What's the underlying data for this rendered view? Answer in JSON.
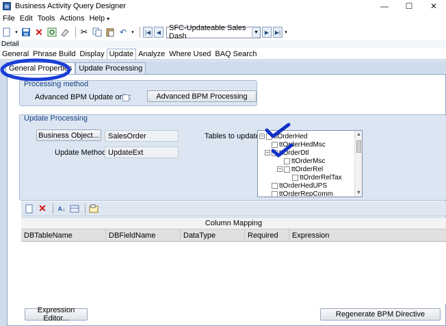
{
  "window": {
    "title": "Business Activity Query Designer",
    "controls": [
      "—",
      "☐",
      "✕"
    ]
  },
  "menu": [
    "File",
    "Edit",
    "Tools",
    "Actions",
    "Help"
  ],
  "toolbar": {
    "query_combo": "SFC-Updateable Sales Dash"
  },
  "detail_label": "Detail",
  "main_tabs": [
    "General",
    "Phrase Build",
    "Display",
    "Update",
    "Analyze",
    "Where Used",
    "BAQ Search"
  ],
  "sub_tabs": [
    "General Properties",
    "Update Processing"
  ],
  "processing_method": {
    "title": "Processing method",
    "adv_bpm_label": "Advanced BPM Update only:",
    "adv_bpm_button": "Advanced BPM Processing"
  },
  "update_processing": {
    "title": "Update Processing",
    "business_object_button": "Business Object...",
    "business_object_value": "SalesOrder",
    "update_method_label": "Update Method:",
    "update_method_value": "UpdateExt",
    "tables_label": "Tables to update:",
    "tree": [
      {
        "text": "ttOrderHed"
      },
      {
        "text": "ttOrderHedMsc"
      },
      {
        "text": "ttOrderDtl"
      },
      {
        "text": "ttOrderMsc"
      },
      {
        "text": "ttOrderRel"
      },
      {
        "text": "ttOrderRelTax"
      },
      {
        "text": "ttOrderHedUPS"
      },
      {
        "text": "ttOrderRepComm"
      }
    ]
  },
  "grid": {
    "band": "Column Mapping",
    "columns": [
      "DBTableName",
      "DBFieldName",
      "DataType",
      "Required",
      "Expression"
    ]
  },
  "footer": {
    "expression_editor": "Expression Editor...",
    "regenerate": "Regenerate BPM Directive"
  },
  "colors": {
    "accent": "#1a3fd8",
    "checkmark": "#1030c8"
  }
}
